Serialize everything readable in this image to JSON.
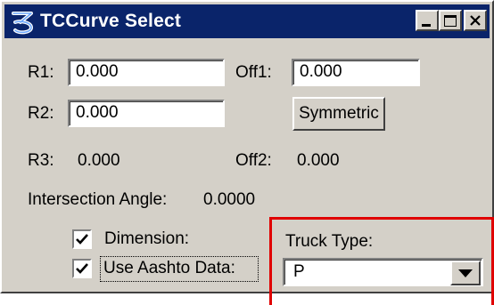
{
  "window": {
    "title": "TCCurve Select",
    "controls": [
      "minimize",
      "maximize",
      "close"
    ]
  },
  "fields": {
    "r1": {
      "label": "R1:",
      "value": "0.000"
    },
    "off1": {
      "label": "Off1:",
      "value": "0.000"
    },
    "r2": {
      "label": "R2:",
      "value": "0.000"
    }
  },
  "buttons": {
    "symmetric": "Symmetric"
  },
  "readouts": {
    "r3": {
      "label": "R3:",
      "value": "0.000"
    },
    "off2": {
      "label": "Off2:",
      "value": "0.000"
    },
    "intersection_angle": {
      "label": "Intersection Angle:",
      "value": "0.0000"
    }
  },
  "checkboxes": {
    "dimension": {
      "label": "Dimension:",
      "checked": true
    },
    "use_aashto": {
      "label": "Use Aashto Data:",
      "checked": true
    }
  },
  "truck_type": {
    "label": "Truck Type:",
    "selected": "P"
  },
  "colors": {
    "title_bar": "#0a246a",
    "dialog_bg": "#d4d0c8",
    "highlight": "#e00000"
  },
  "icons": {
    "app": "tccurve-logo-icon",
    "minimize": "minimize-icon",
    "maximize": "maximize-icon",
    "close": "close-icon",
    "dropdown": "chevron-down-icon",
    "check": "checkmark-icon"
  }
}
